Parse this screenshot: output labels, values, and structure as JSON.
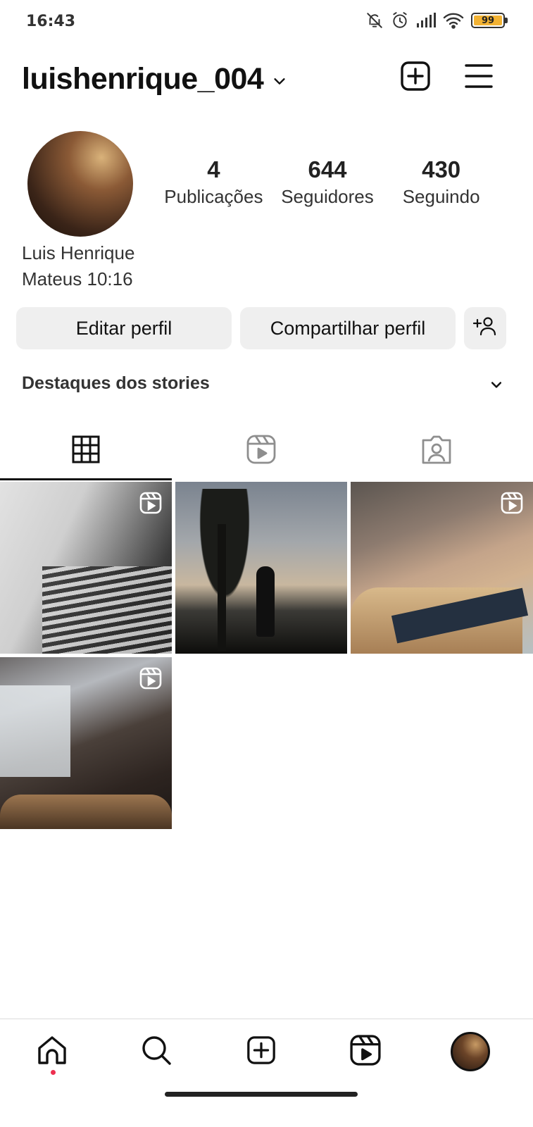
{
  "status_bar": {
    "time": "16:43",
    "icons": [
      "bell-muted-icon",
      "alarm-icon",
      "signal-icon",
      "wifi-icon",
      "battery-icon"
    ],
    "battery_level": "99"
  },
  "header": {
    "username": "luishenrique_004",
    "icons": [
      "chevron-down-icon",
      "create-post-icon",
      "menu-icon"
    ]
  },
  "profile": {
    "stats": [
      {
        "value": "4",
        "label": "Publicações"
      },
      {
        "value": "644",
        "label": "Seguidores"
      },
      {
        "value": "430",
        "label": "Seguindo"
      }
    ],
    "name": "Luis Henrique",
    "bio": "Mateus 10:16"
  },
  "actions": {
    "edit_label": "Editar perfil",
    "share_label": "Compartilhar perfil",
    "discover_icon": "add-person-icon"
  },
  "highlights": {
    "title": "Destaques dos stories"
  },
  "tabs": [
    {
      "name": "posts",
      "icon": "grid-icon",
      "active": true
    },
    {
      "name": "reels",
      "icon": "reels-icon",
      "active": false
    },
    {
      "name": "tagged",
      "icon": "tagged-icon",
      "active": false
    }
  ],
  "posts": [
    {
      "type": "reel"
    },
    {
      "type": "photo"
    },
    {
      "type": "reel"
    },
    {
      "type": "reel"
    }
  ],
  "bottom_nav": [
    "home-icon",
    "search-icon",
    "create-icon",
    "reels-icon",
    "profile-avatar"
  ],
  "colors": {
    "button_bg": "#efefef",
    "notification_dot": "#ed2f4f",
    "battery": "#f2b233"
  }
}
